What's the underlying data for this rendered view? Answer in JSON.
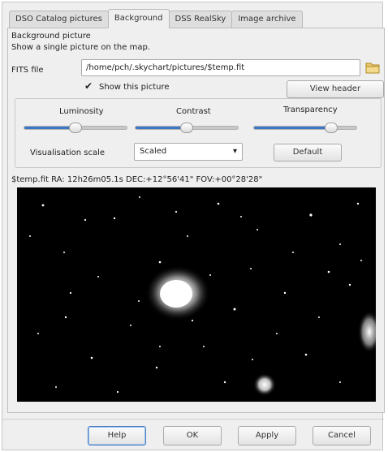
{
  "tabs": [
    {
      "label": "DSO Catalog pictures"
    },
    {
      "label": "Background"
    },
    {
      "label": "DSS RealSky"
    },
    {
      "label": "Image archive"
    }
  ],
  "background": {
    "section_title": "Background picture",
    "description": "Show a single picture on the map.",
    "fits_label": "FITS file",
    "fits_path": "/home/pch/.skychart/pictures/$temp.fit",
    "show_picture_label": "Show this picture",
    "show_picture_checked": true,
    "view_header_label": "View header"
  },
  "adjustments": {
    "luminosity_label": "Luminosity",
    "luminosity_level": 0.5,
    "contrast_label": "Contrast",
    "contrast_level": 0.5,
    "transparency_label": "Transparency",
    "transparency_level": 0.75,
    "visualisation_label": "Visualisation scale",
    "visualisation_value": "Scaled",
    "default_label": "Default"
  },
  "image_info": "$temp.fit RA: 12h26m05.1s DEC:+12°56'41\" FOV:+00°28'28\"",
  "footer": {
    "help_label": "Help",
    "ok_label": "OK",
    "apply_label": "Apply",
    "cancel_label": "Cancel"
  },
  "colors": {
    "accent": "#3b77c6",
    "focus_border": "#4a7fc4"
  }
}
